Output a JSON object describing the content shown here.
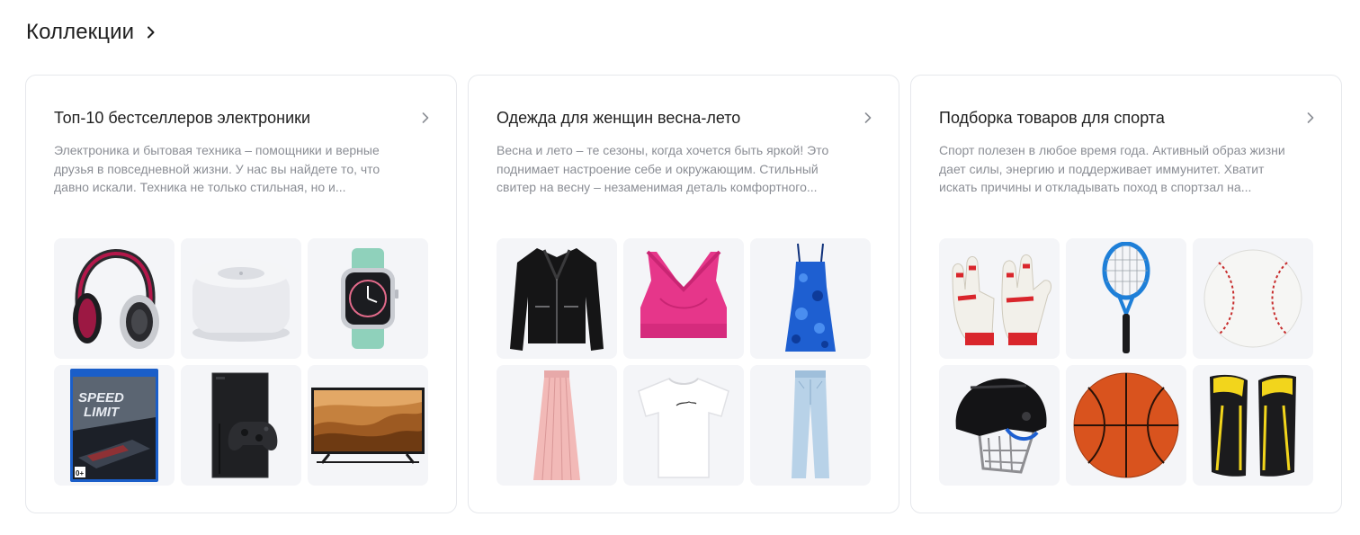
{
  "section": {
    "title": "Коллекции"
  },
  "collections": [
    {
      "title": "Топ-10 бестселлеров электроники",
      "description": "Электроника и бытовая техника – помощники и верные друзья в повседневной жизни. У нас вы найдете то, что давно искали. Техника не только стильная, но и...",
      "products": [
        "headphones",
        "smart speaker",
        "smartwatch",
        "game disc",
        "game console",
        "tv"
      ],
      "game_cover": {
        "line1": "SPEED",
        "line2": "LIMIT",
        "rating": "0+"
      }
    },
    {
      "title": "Одежда для женщин весна-лето",
      "description": "Весна и лето – те сезоны, когда хочется быть яркой! Это поднимает настроение себе и окружающим. Стильный свитер на весну – незаменимая деталь комфортного...",
      "products": [
        "leather jacket",
        "sports bra",
        "blue dress",
        "pleated skirt",
        "white t-shirt",
        "jeans"
      ]
    },
    {
      "title": "Подборка товаров для спорта",
      "description": "Спорт полезен в любое время года. Активный образ жизни дает силы, энергию и поддерживает иммунитет. Хватит искать причины и откладывать поход в спортзал на...",
      "products": [
        "goalkeeper gloves",
        "tennis racket",
        "baseball",
        "hockey helmet",
        "basketball",
        "shin guards"
      ]
    }
  ],
  "colors": {
    "tile_bg": "#f4f5f8",
    "card_border": "#e6e8ec",
    "muted_text": "#8b8e95"
  }
}
